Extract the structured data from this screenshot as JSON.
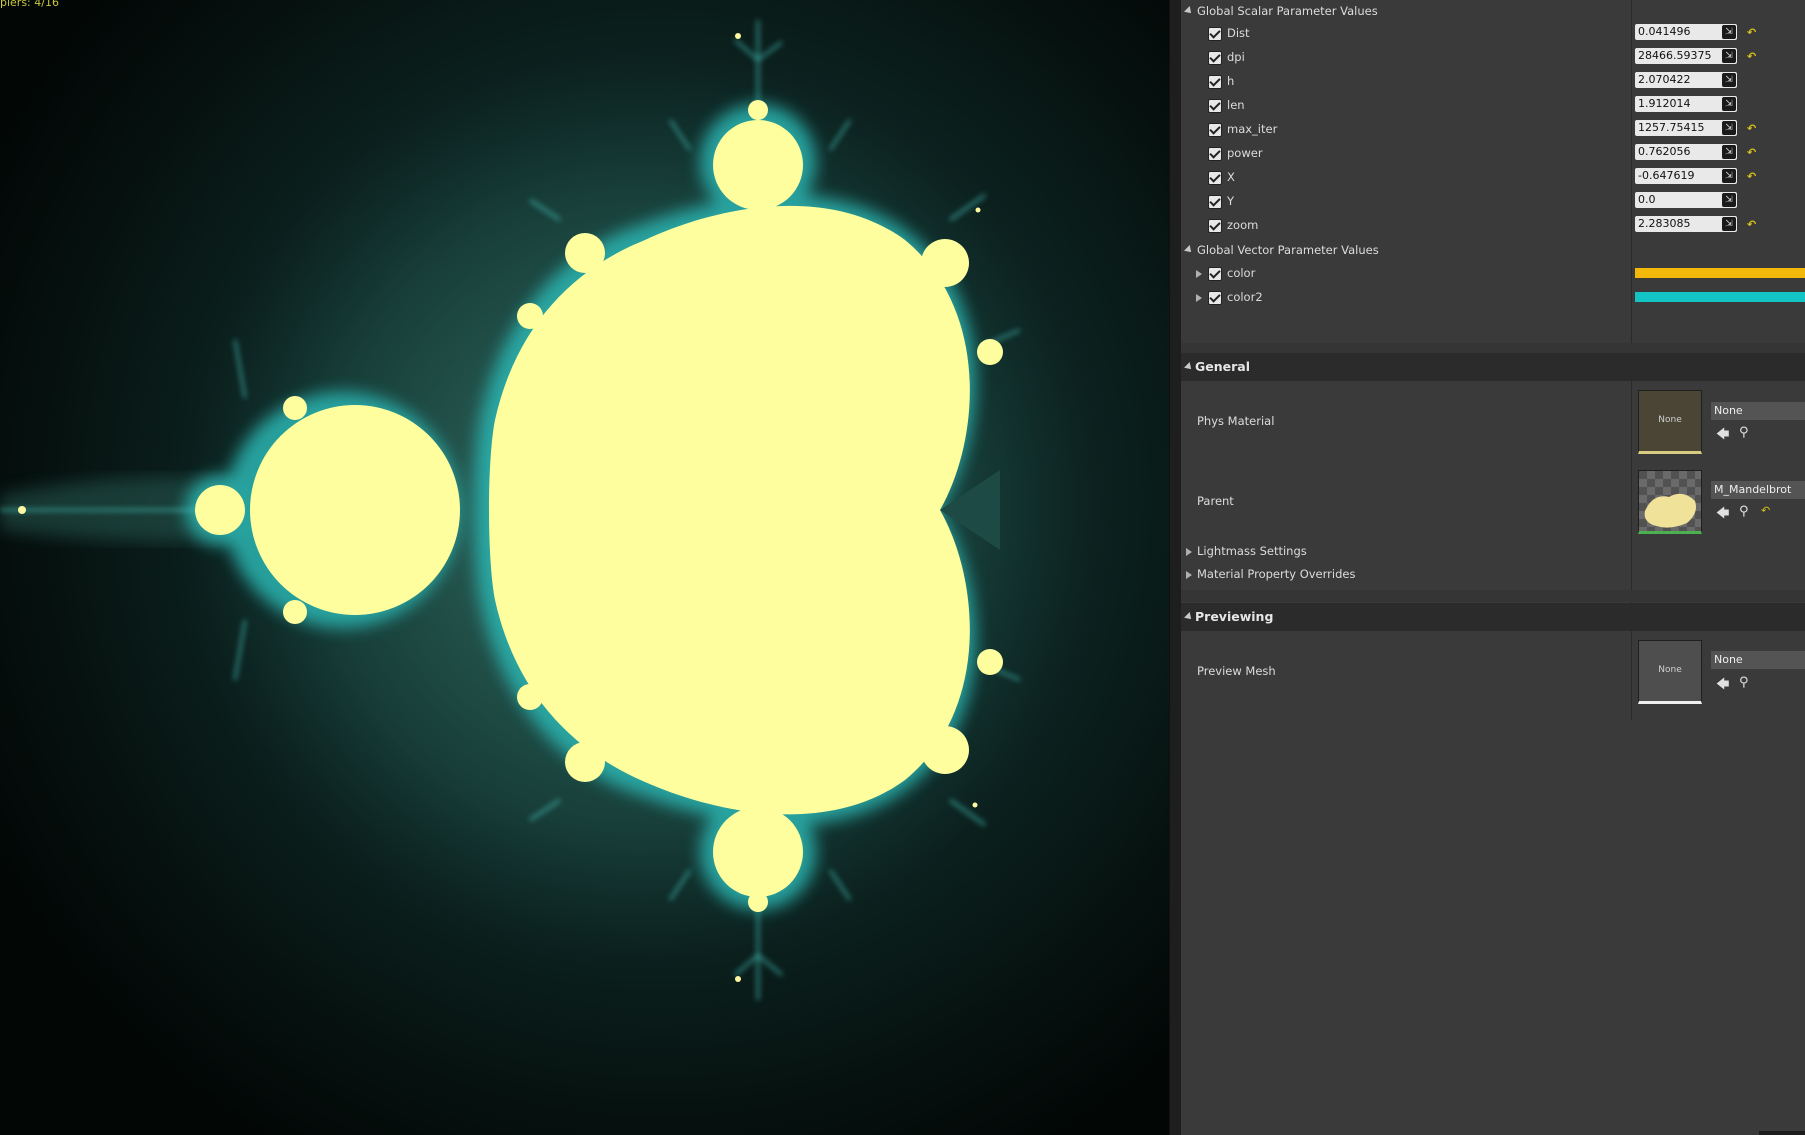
{
  "viewport": {
    "stats_text": "piers: 4/16",
    "fractal": {
      "inner_color": "#fffe9e",
      "edge_color": "#2bb4b0",
      "background_color": "#020605"
    }
  },
  "details": {
    "scalar_group": {
      "label": "Global Scalar Parameter Values",
      "params": [
        {
          "name": "Dist",
          "value": "0.041496",
          "reset": true
        },
        {
          "name": "dpi",
          "value": "28466.59375",
          "reset": true
        },
        {
          "name": "h",
          "value": "2.070422",
          "reset": false
        },
        {
          "name": "len",
          "value": "1.912014",
          "reset": false
        },
        {
          "name": "max_iter",
          "value": "1257.75415",
          "reset": true
        },
        {
          "name": "power",
          "value": "0.762056",
          "reset": true
        },
        {
          "name": "X",
          "value": "-0.647619",
          "reset": true
        },
        {
          "name": "Y",
          "value": "0.0",
          "reset": false
        },
        {
          "name": "zoom",
          "value": "2.283085",
          "reset": true
        }
      ]
    },
    "vector_group": {
      "label": "Global Vector Parameter Values",
      "params": [
        {
          "name": "color",
          "swatch": "#f2b90a"
        },
        {
          "name": "color2",
          "swatch": "#12c4c4"
        }
      ]
    },
    "general": {
      "title": "General",
      "phys_material": {
        "label": "Phys Material",
        "thumb_text": "None",
        "value": "None"
      },
      "parent": {
        "label": "Parent",
        "value": "M_Mandelbrot"
      },
      "lightmass": "Lightmass Settings",
      "overrides": "Material Property Overrides"
    },
    "previewing": {
      "title": "Previewing",
      "preview_mesh": {
        "label": "Preview Mesh",
        "thumb_text": "None",
        "value": "None"
      }
    },
    "icons": {
      "use": "arrow-left-icon",
      "browse": "search-icon",
      "reset": "reset-arrow-icon",
      "spin": "drag-spinner-icon"
    }
  }
}
